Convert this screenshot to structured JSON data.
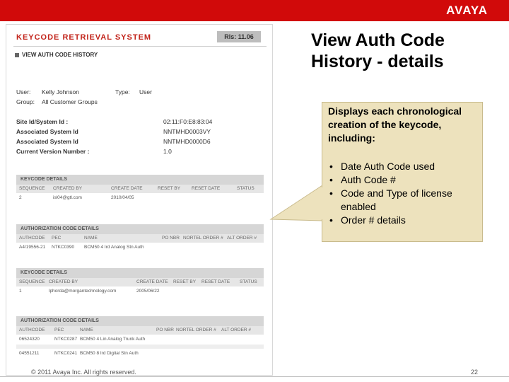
{
  "brand": {
    "logo_text": "AVAYA",
    "accent": "#d10a0a"
  },
  "slide": {
    "title": "View Auth Code History - details",
    "page": "22",
    "footer": "© 2011 Avaya Inc. All rights reserved."
  },
  "app": {
    "title": "KEYCODE RETRIEVAL SYSTEM",
    "release": "Rls: 11.06",
    "subheader": "VIEW AUTH CODE HISTORY",
    "user_label": "User:",
    "user_value": "Kelly Johnson",
    "type_label": "Type:",
    "type_value": "User",
    "group_label": "Group:",
    "group_value": "All Customer Groups",
    "site_label": "Site Id/System Id :",
    "site_value": "02:11:F0:E8:83:04",
    "assoc1_label": "Associated System Id",
    "assoc1_value": "NNTMHD0003VY",
    "assoc2_label": "Associated System Id",
    "assoc2_value": "NNTMHD0000D6",
    "version_label": "Current Version Number :",
    "version_value": "1.0"
  },
  "keycode_details_1": {
    "title": "KEYCODE DETAILS",
    "headers": [
      "SEQUENCE",
      "CREATED BY",
      "CREATE DATE",
      "RESET BY",
      "RESET DATE",
      "STATUS"
    ],
    "rows": [
      [
        "2",
        "isl04@gtl.com",
        "2010/04/05",
        "",
        "",
        ""
      ]
    ]
  },
  "auth_details_1": {
    "title": "AUTHORIZATION CODE DETAILS",
    "headers": [
      "AUTHCODE",
      "PEC",
      "NAME",
      "PO NBR",
      "NORTEL ORDER #",
      "ALT ORDER #"
    ],
    "rows": [
      [
        "A4/19556-21",
        "NTKC0390",
        "BCM50 4 Ird Analog Stn Auth",
        "",
        "",
        ""
      ]
    ]
  },
  "keycode_details_2": {
    "title": "KEYCODE DETAILS",
    "headers": [
      "SEQUENCE",
      "CREATED BY",
      "CREATE DATE",
      "RESET BY",
      "RESET DATE",
      "STATUS"
    ],
    "rows": [
      [
        "1",
        "lphorda@morgantechnology.com",
        "2005/06/22",
        "",
        "",
        ""
      ]
    ]
  },
  "auth_details_2": {
    "title": "AUTHORIZATION CODE DETAILS",
    "headers": [
      "AUTHCODE",
      "PEC",
      "NAME",
      "PO NBR",
      "NORTEL ORDER #",
      "ALT ORDER #"
    ],
    "rows": [
      [
        "06524320",
        "NTKC0287",
        "BCM50 4 Lin Analog Trunk Auth",
        "",
        "",
        ""
      ],
      [
        "04551211",
        "NTKC0241",
        "BCM50 8 Ird Digital Stn Auth",
        "",
        "",
        ""
      ]
    ]
  },
  "callout": {
    "intro": "Displays each chronological creation of the keycode, including:",
    "bullets": [
      "Date Auth Code used",
      "Auth Code #",
      "Code and Type of license enabled",
      " Order # details"
    ],
    "bg": "#ede2bd"
  }
}
